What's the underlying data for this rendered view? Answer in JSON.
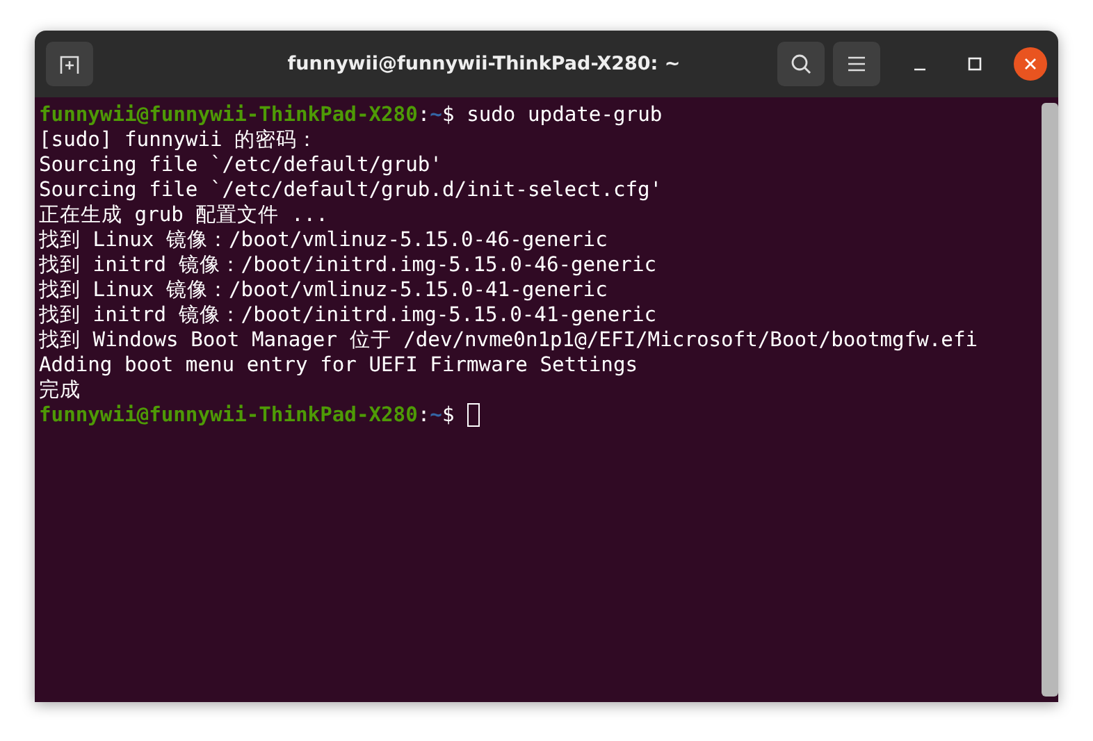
{
  "window": {
    "title": "funnywii@funnywii-ThinkPad-X280: ~"
  },
  "terminal": {
    "lines": [
      {
        "kind": "prompt",
        "user_host": "funnywii@funnywii-ThinkPad-X280",
        "separator": ":",
        "path": "~",
        "symbol": "$",
        "command": "sudo update-grub"
      },
      {
        "kind": "output",
        "text": "[sudo] funnywii 的密码："
      },
      {
        "kind": "output",
        "text": "Sourcing file `/etc/default/grub'"
      },
      {
        "kind": "output",
        "text": "Sourcing file `/etc/default/grub.d/init-select.cfg'"
      },
      {
        "kind": "output",
        "text": "正在生成 grub 配置文件 ..."
      },
      {
        "kind": "output",
        "text": "找到 Linux 镜像：/boot/vmlinuz-5.15.0-46-generic"
      },
      {
        "kind": "output",
        "text": "找到 initrd 镜像：/boot/initrd.img-5.15.0-46-generic"
      },
      {
        "kind": "output",
        "text": "找到 Linux 镜像：/boot/vmlinuz-5.15.0-41-generic"
      },
      {
        "kind": "output",
        "text": "找到 initrd 镜像：/boot/initrd.img-5.15.0-41-generic"
      },
      {
        "kind": "output",
        "text": "找到 Windows Boot Manager 位于 /dev/nvme0n1p1@/EFI/Microsoft/Boot/bootmgfw.efi"
      },
      {
        "kind": "output",
        "text": "Adding boot menu entry for UEFI Firmware Settings"
      },
      {
        "kind": "output",
        "text": "完成"
      },
      {
        "kind": "prompt",
        "user_host": "funnywii@funnywii-ThinkPad-X280",
        "separator": ":",
        "path": "~",
        "symbol": "$",
        "cursor": true
      }
    ]
  }
}
